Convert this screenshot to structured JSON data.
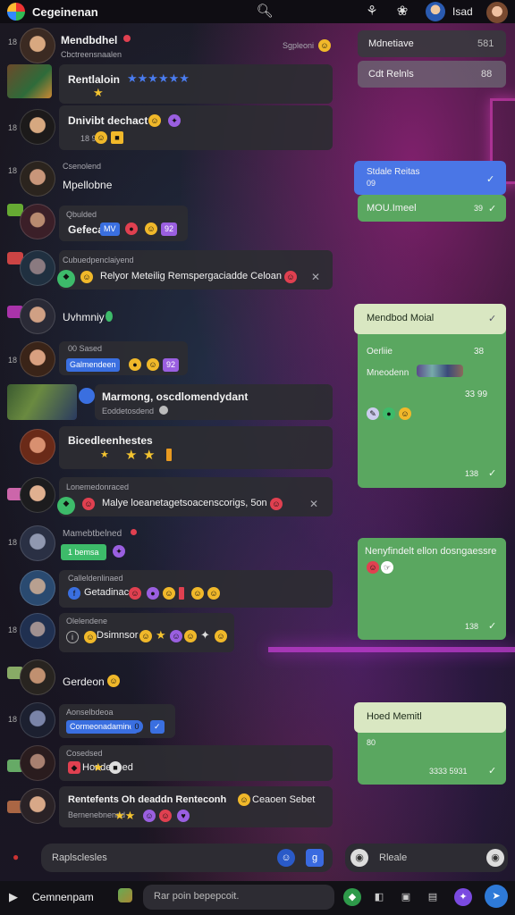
{
  "header": {
    "app_title": "Cegeinenan",
    "user_name": "Isad",
    "icons": [
      "search-icon",
      "activity-icon",
      "settings-icon",
      "avatar-icon"
    ]
  },
  "chat_rows": [
    {
      "id": 1,
      "name": "Mendbdhel",
      "sub": "Cbctreensnaalen",
      "time": "Sgpleoni"
    },
    {
      "id": 2,
      "name": "Rentlaloin",
      "time": ""
    },
    {
      "id": 3,
      "name": "Dnivibt dechact",
      "sub": "18 98",
      "time": ""
    },
    {
      "id": 4,
      "name": "Mpellobne",
      "sub": "Csenolend",
      "time": ""
    },
    {
      "id": 5,
      "name": "Gefecal",
      "sub": "Qbulded",
      "chips": [
        "MV",
        "92"
      ]
    },
    {
      "id": 6,
      "name": "Relyor Meteilig Remspergaciadde Celoan",
      "sub": "Cubuedpenclaiyend"
    },
    {
      "id": 7,
      "name": "Uvhmniy"
    },
    {
      "id": 8,
      "name": "Galmendeen",
      "sub": "00 Sased",
      "chips": [
        "92"
      ]
    },
    {
      "id": 9,
      "name": "Marmong, oscdlomendydant",
      "sub": "Eoddetosdend"
    },
    {
      "id": 10,
      "name": "Bicedleenhestes"
    },
    {
      "id": 11,
      "name": "Malye loeanetagetsoacenscorigs, 5on",
      "sub": "Lonemedonraced"
    },
    {
      "id": 12,
      "name": "Mamebtbelned",
      "chip": "1 bemsa"
    },
    {
      "id": 13,
      "name": "Getadinac",
      "sub": "Calleldenlinaed"
    },
    {
      "id": 14,
      "name": "Dsimnsor",
      "sub": "Olelendene"
    },
    {
      "id": 15,
      "name": "Gerdeon"
    },
    {
      "id": 16,
      "name": "Cormeonadamine",
      "sub": "Aonselbdeoa"
    },
    {
      "id": 17,
      "name": "Hondenbed",
      "sub": "Cosedsed"
    },
    {
      "id": 18,
      "name": "Rentefents Oh deaddn Renteconh",
      "sub": "Bernenebnennd",
      "extra": "Ceaoen Sebet"
    }
  ],
  "right_panel": {
    "items": [
      {
        "label": "Mdnetiave",
        "value": "581"
      },
      {
        "label": "Cdt Relnls",
        "value": "88"
      }
    ],
    "msg_blue": {
      "title": "Stdale Reitas",
      "sub": "09",
      "body": "MOU.Imeel",
      "time": "39"
    },
    "msg_big1": {
      "head": "Mendbod Moial",
      "l1": "Oerliie",
      "l1v": "38",
      "l2": "Mneodenn",
      "l2v": "33 99",
      "time": "138"
    },
    "msg_big2": {
      "head": "Nenyfindelt ellon dosngaessre",
      "time": "138"
    },
    "msg_big3": {
      "head": "Hoed Memitl",
      "sub": "80",
      "time": "3333 5931"
    }
  },
  "compose": {
    "input_placeholder": "Raplsclesles",
    "right_input": "Rleale",
    "bottom_label": "Cemnenpam",
    "bottom_input": "Rar poin bepepcoit."
  }
}
